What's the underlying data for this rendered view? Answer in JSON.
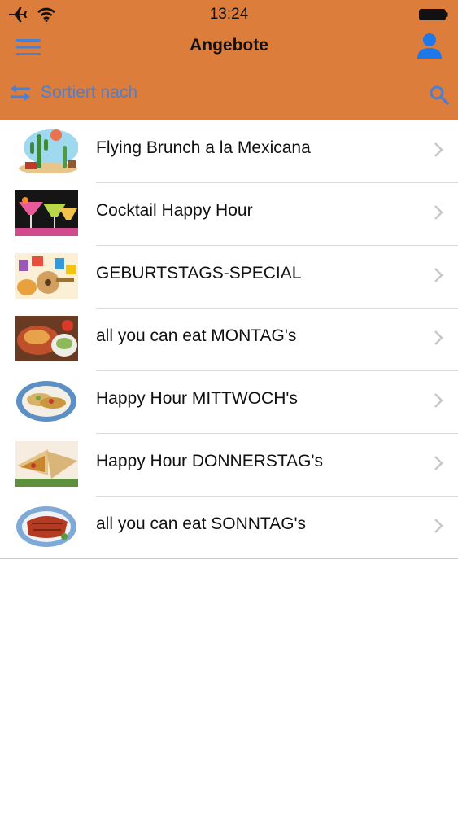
{
  "status_bar": {
    "time": "13:24",
    "icons": [
      "airplane-icon",
      "wifi-icon",
      "battery-icon"
    ]
  },
  "nav": {
    "title": "Angebote",
    "left_icon": "hamburger-menu-icon",
    "right_icon": "user-profile-icon"
  },
  "toolbar": {
    "sort_label": "Sortiert nach",
    "sort_icon": "swap-arrows-icon",
    "search_icon": "search-icon"
  },
  "offers": [
    {
      "title": "Flying Brunch a la Mexicana"
    },
    {
      "title": "Cocktail Happy Hour"
    },
    {
      "title": "GEBURTSTAGS-SPECIAL"
    },
    {
      "title": "all you can eat MONTAG's"
    },
    {
      "title": "Happy Hour MITTWOCH's"
    },
    {
      "title": "Happy Hour DONNERSTAG's"
    },
    {
      "title": "all you can eat SONNTAG's"
    }
  ],
  "colors": {
    "header_bg": "#DC7D3C",
    "accent_blue": "#4A7FD4",
    "chevron": "#C7C7CC"
  }
}
